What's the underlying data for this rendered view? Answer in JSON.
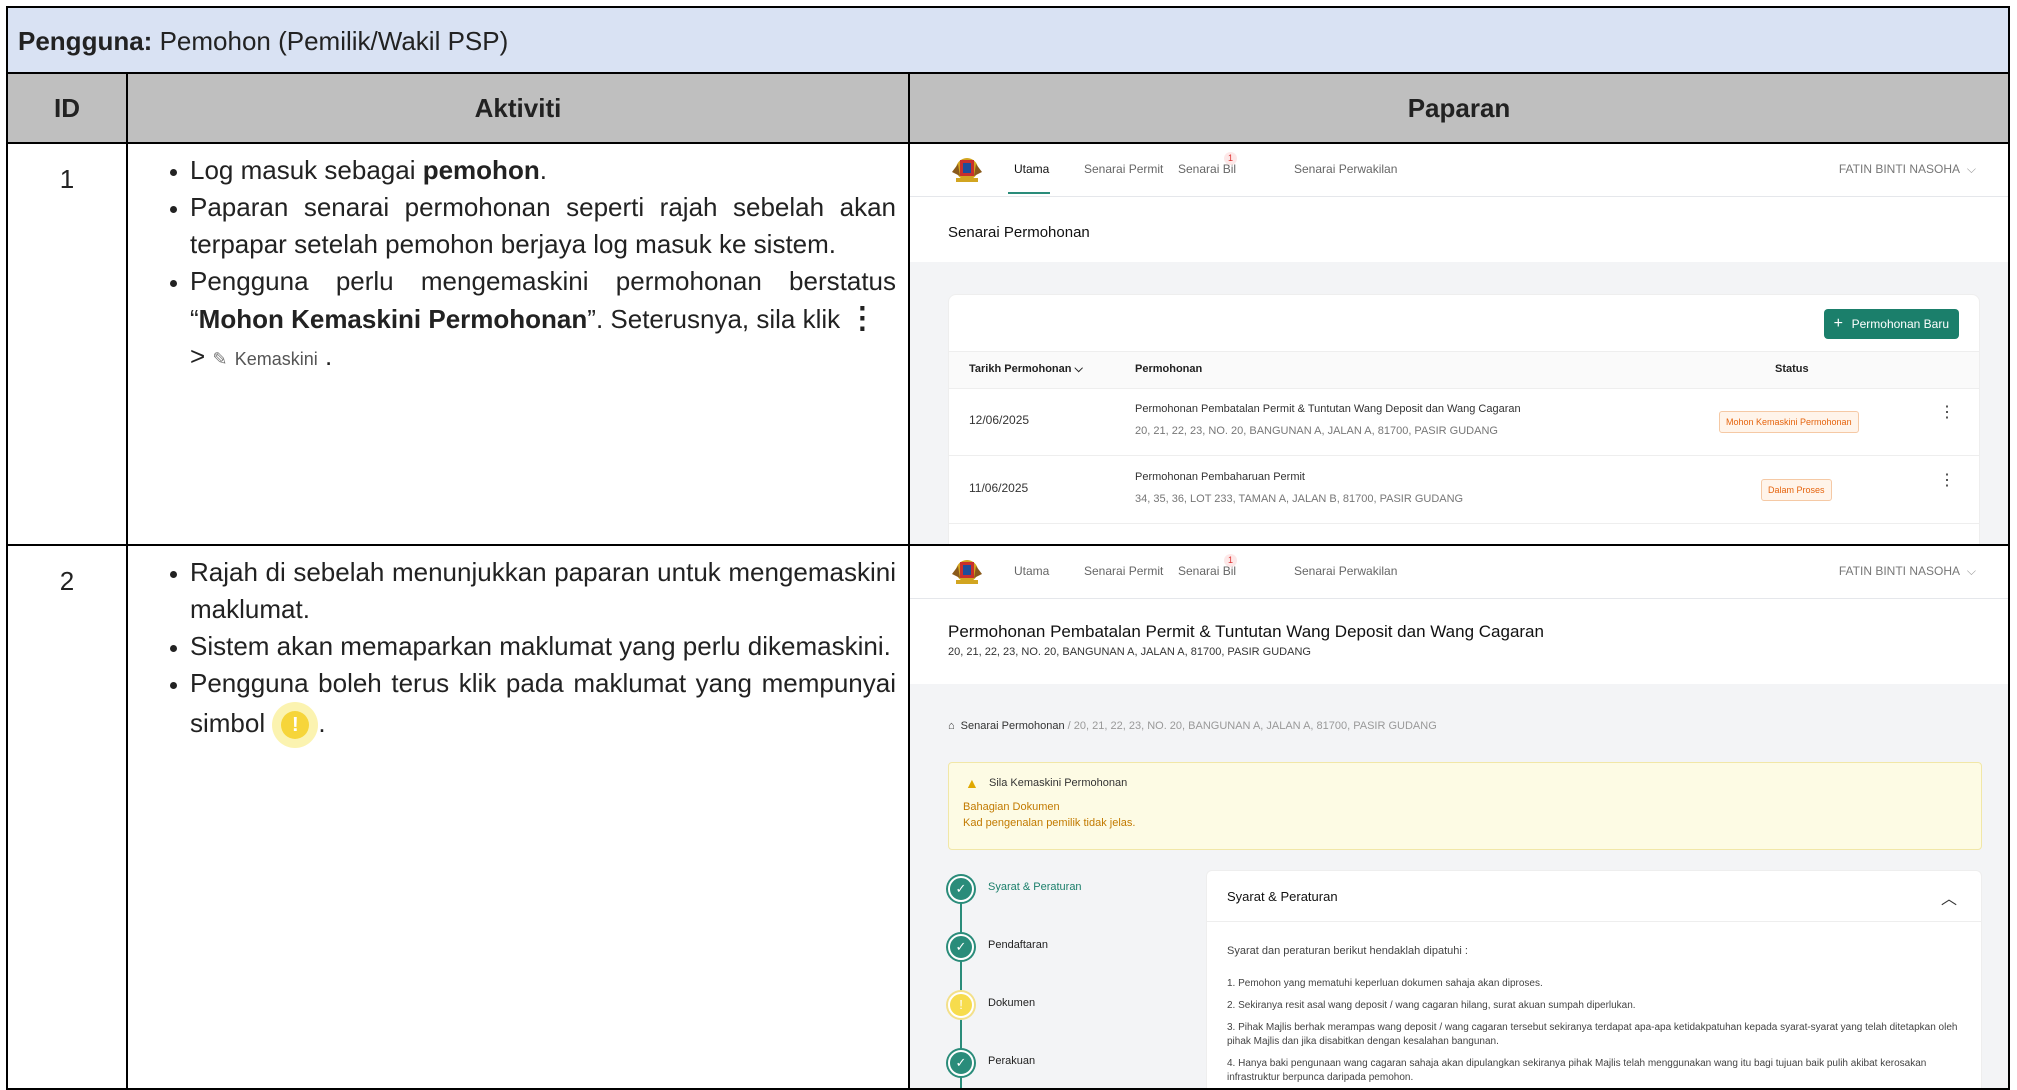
{
  "user_bar": {
    "label": "Pengguna:",
    "value": " Pemohon (Pemilik/Wakil PSP)"
  },
  "table": {
    "headers": [
      "ID",
      "Aktiviti",
      "Paparan"
    ]
  },
  "rows": [
    {
      "id": "1",
      "b1_pre": "Log masuk sebagai ",
      "b1_bold": "pemohon",
      "b1_post": ".",
      "b2": "Paparan senarai permohonan seperti rajah sebelah akan terpapar setelah pemohon berjaya log masuk ke sistem.",
      "b3_pre": "Pengguna perlu mengemaskini permohonan berstatus “",
      "b3_bold": "Mohon Kemaskini Permohonan",
      "b3_post": "”. Seterusnya, sila klik ",
      "b3_kebab": "⋮",
      "b3_gt": "> ",
      "b3_edit_icon": "✎",
      "b3_edit_label": "Kemaskini",
      "b3_end": "."
    },
    {
      "id": "2",
      "b1": "Rajah di sebelah menunjukkan paparan untuk mengemaskini maklumat.",
      "b2": "Sistem akan memaparkan maklumat yang perlu dikemaskini.",
      "b3_pre": "Pengguna boleh terus klik pada maklumat yang mempunyai simbol ",
      "b3_end": "."
    }
  ],
  "app": {
    "nav": {
      "utama": "Utama",
      "senarai_permit": "Senarai Permit",
      "senarai_bil": "Senarai Bil",
      "bil_badge": "1",
      "senarai_perwakilan": "Senarai Perwakilan",
      "user": "FATIN BINTI NASOHA",
      "chevron": "⌵"
    },
    "screen1": {
      "title": "Senarai Permohonan",
      "new_button": "Permohonan Baru",
      "plus": "+",
      "col_date": "Tarikh Permohonan ⌵",
      "col_app": "Permohonan",
      "col_status": "Status",
      "rows": [
        {
          "date": "12/06/2025",
          "title": "Permohonan Pembatalan Permit & Tuntutan Wang Deposit dan Wang Cagaran",
          "address": "20, 21, 22, 23, NO. 20, BANGUNAN A, JALAN A, 81700, PASIR GUDANG",
          "status": "Mohon Kemaskini Permohonan",
          "kebab": "⋮"
        },
        {
          "date": "11/06/2025",
          "title": "Permohonan Pembaharuan Permit",
          "address": "34, 35, 36, LOT 233, TAMAN A, JALAN B, 81700, PASIR GUDANG",
          "status": "Dalam Proses",
          "kebab": "⋮"
        }
      ]
    },
    "screen2": {
      "title": "Permohonan Pembatalan Permit & Tuntutan Wang Deposit dan Wang Cagaran",
      "subtitle": "20, 21, 22, 23, NO. 20, BANGUNAN A, JALAN A, 81700, PASIR GUDANG",
      "crumb_home_icon": "⌂",
      "crumb_root": "Senarai Permohonan",
      "crumb_sep": " / ",
      "crumb_current": "20, 21, 22, 23, NO. 20, BANGUNAN A, JALAN A, 81700, PASIR GUDANG",
      "alert_icon": "▲",
      "alert_title": "Sila Kemaskini Permohonan",
      "alert_line1": "Bahagian Dokumen",
      "alert_line2": "Kad pengenalan pemilik tidak jelas.",
      "steps": [
        {
          "label": "Syarat & Peraturan",
          "icon": "✓",
          "state": "done"
        },
        {
          "label": "Pendaftaran",
          "icon": "✓",
          "state": "done"
        },
        {
          "label": "Dokumen",
          "icon": "!",
          "state": "warn"
        },
        {
          "label": "Perakuan",
          "icon": "✓",
          "state": "done"
        }
      ],
      "section_title": "Syarat & Peraturan",
      "section_toggle": "︿",
      "section_intro": "Syarat dan peraturan berikut hendaklah dipatuhi :",
      "rules": [
        "1.  Pemohon yang mematuhi keperluan dokumen sahaja akan diproses.",
        "2.  Sekiranya resit asal wang deposit / wang cagaran hilang, surat akuan sumpah diperlukan.",
        "3.  Pihak Majlis berhak merampas wang deposit / wang cagaran tersebut sekiranya terdapat apa-apa ketidakpatuhan kepada syarat-syarat yang telah ditetapkan oleh pihak Majlis dan jika disabitkan dengan kesalahan bangunan.",
        "4.  Hanya baki pengunaan wang cagaran sahaja akan dipulangkan sekiranya pihak Majlis telah menggunakan wang itu bagi tujuan baik pulih akibat kerosakan infrastruktur berpunca daripada pemohon."
      ]
    }
  }
}
